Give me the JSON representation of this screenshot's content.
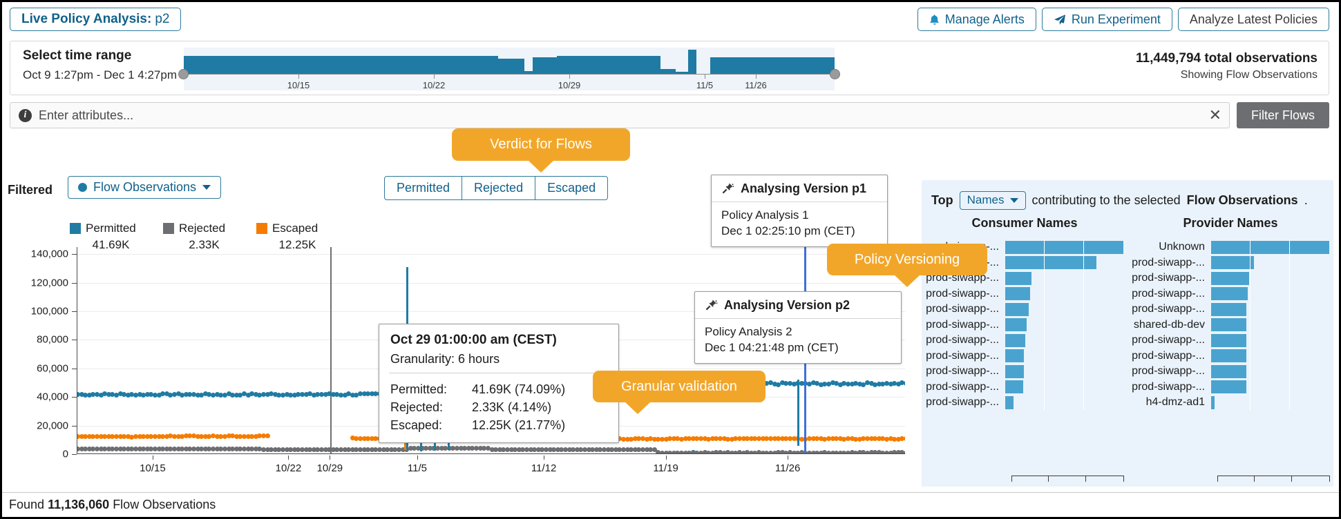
{
  "header": {
    "title_bold": "Live Policy Analysis:",
    "title_rest": "p2",
    "buttons": [
      {
        "label": "Manage Alerts",
        "icon": "bell-icon"
      },
      {
        "label": "Run Experiment",
        "icon": "paper-plane-icon"
      },
      {
        "label": "Analyze Latest Policies",
        "icon": "none"
      }
    ]
  },
  "time_range": {
    "label": "Select time range",
    "value": "Oct 9 1:27pm - Dec 1 4:27pm",
    "ticks": [
      "10/15",
      "10/22",
      "10/29",
      "11/5",
      "11/26"
    ],
    "total_observations": "11,449,794 total observations",
    "showing": "Showing Flow Observations"
  },
  "filter": {
    "placeholder": "Enter attributes...",
    "value": "",
    "clear_label": "✕",
    "button_label": "Filter Flows"
  },
  "controls": {
    "filtered_label": "Filtered",
    "flow_selector": "Flow Observations",
    "verdicts": [
      "Permitted",
      "Rejected",
      "Escaped"
    ]
  },
  "legend": [
    {
      "name": "Permitted",
      "value": "41.69K",
      "color": "#1f7ba4"
    },
    {
      "name": "Rejected",
      "value": "2.33K",
      "color": "#6d6e71"
    },
    {
      "name": "Escaped",
      "value": "12.25K",
      "color": "#f57c00"
    }
  ],
  "chart_data": {
    "type": "scatter",
    "title": "",
    "xlabel": "",
    "ylabel": "",
    "ylim": [
      0,
      145000
    ],
    "yticks": [
      0,
      20000,
      40000,
      60000,
      80000,
      100000,
      120000,
      140000
    ],
    "ytick_labels": [
      "0",
      "20,000",
      "40,000",
      "60,000",
      "80,000",
      "100,000",
      "120,000",
      "140,000"
    ],
    "xticks": [
      "10/15",
      "10/22",
      "10/29",
      "11/5",
      "11/12",
      "11/19",
      "11/26"
    ],
    "xtick_positions_pct": [
      16.5,
      46.0,
      55.0,
      74.0,
      101.5,
      128.0,
      154.5
    ],
    "grid": true,
    "legend_position": "top-left",
    "series": [
      {
        "name": "Permitted",
        "color": "#1f7ba4",
        "baseline": 42000,
        "summary_value": "41.69K",
        "summary_pct": "74.09%"
      },
      {
        "name": "Rejected",
        "color": "#6d6e71",
        "baseline": 3500,
        "summary_value": "2.33K",
        "summary_pct": "4.14%"
      },
      {
        "name": "Escaped",
        "color": "#f57c00",
        "baseline": 11500,
        "summary_value": "12.25K",
        "summary_pct": "21.77%"
      }
    ],
    "peak": {
      "label": "11/5 spike",
      "value": 131000,
      "series": "Permitted"
    },
    "marker_lines": [
      {
        "label": "Analysing Version p1",
        "x_pct": 55.0,
        "color": "#6d6e71"
      },
      {
        "label": "Analysing Version p2",
        "x_pct": 158.0,
        "color": "#3f6fd8"
      }
    ]
  },
  "tooltips": {
    "p1": {
      "icon": "plug-icon",
      "title": "Analysing Version p1",
      "line1": "Policy Analysis 1",
      "line2": "Dec 1 02:25:10 pm (CET)"
    },
    "p2": {
      "icon": "plug-icon",
      "title": "Analysing Version p2",
      "line1": "Policy Analysis 2",
      "line2": "Dec 1 04:21:48 pm (CET)"
    },
    "point": {
      "title": "Oct 29 01:00:00 am (CEST)",
      "subtitle": "Granularity: 6 hours",
      "rows": [
        {
          "key": "Permitted:",
          "value": "41.69K (74.09%)"
        },
        {
          "key": "Rejected:",
          "value": "2.33K (4.14%)"
        },
        {
          "key": "Escaped:",
          "value": "12.25K (21.77%)"
        }
      ]
    }
  },
  "callouts": [
    {
      "text": "Verdict for Flows"
    },
    {
      "text": "Policy Versioning"
    },
    {
      "text": "Granular validation"
    }
  ],
  "right_panel": {
    "top_label": "Top",
    "select_value": "Names",
    "mid_text": "contributing to the selected",
    "bold_text": "Flow Observations",
    "period": ".",
    "consumer_title": "Consumer Names",
    "provider_title": "Provider Names",
    "consumer": [
      {
        "label": "prod-siwapp-...",
        "value": 100
      },
      {
        "label": "prod-siwapp-...",
        "value": 77
      },
      {
        "label": "prod-siwapp-...",
        "value": 22
      },
      {
        "label": "prod-siwapp-...",
        "value": 21
      },
      {
        "label": "prod-siwapp-...",
        "value": 20
      },
      {
        "label": "prod-siwapp-...",
        "value": 18
      },
      {
        "label": "prod-siwapp-...",
        "value": 17
      },
      {
        "label": "prod-siwapp-...",
        "value": 16
      },
      {
        "label": "prod-siwapp-...",
        "value": 16
      },
      {
        "label": "prod-siwapp-...",
        "value": 15
      },
      {
        "label": "prod-siwapp-...",
        "value": 7
      }
    ],
    "provider": [
      {
        "label": "Unknown",
        "value": 100
      },
      {
        "label": "prod-siwapp-...",
        "value": 36
      },
      {
        "label": "prod-siwapp-...",
        "value": 32
      },
      {
        "label": "prod-siwapp-...",
        "value": 31
      },
      {
        "label": "prod-siwapp-...",
        "value": 30
      },
      {
        "label": "shared-db-dev",
        "value": 30
      },
      {
        "label": "prod-siwapp-...",
        "value": 30
      },
      {
        "label": "prod-siwapp-...",
        "value": 30
      },
      {
        "label": "prod-siwapp-...",
        "value": 30
      },
      {
        "label": "prod-siwapp-...",
        "value": 30
      },
      {
        "label": "h4-dmz-ad1",
        "value": 3
      }
    ]
  },
  "footer": {
    "prefix": "Found",
    "count": "11,136,060",
    "suffix": "Flow Observations"
  }
}
